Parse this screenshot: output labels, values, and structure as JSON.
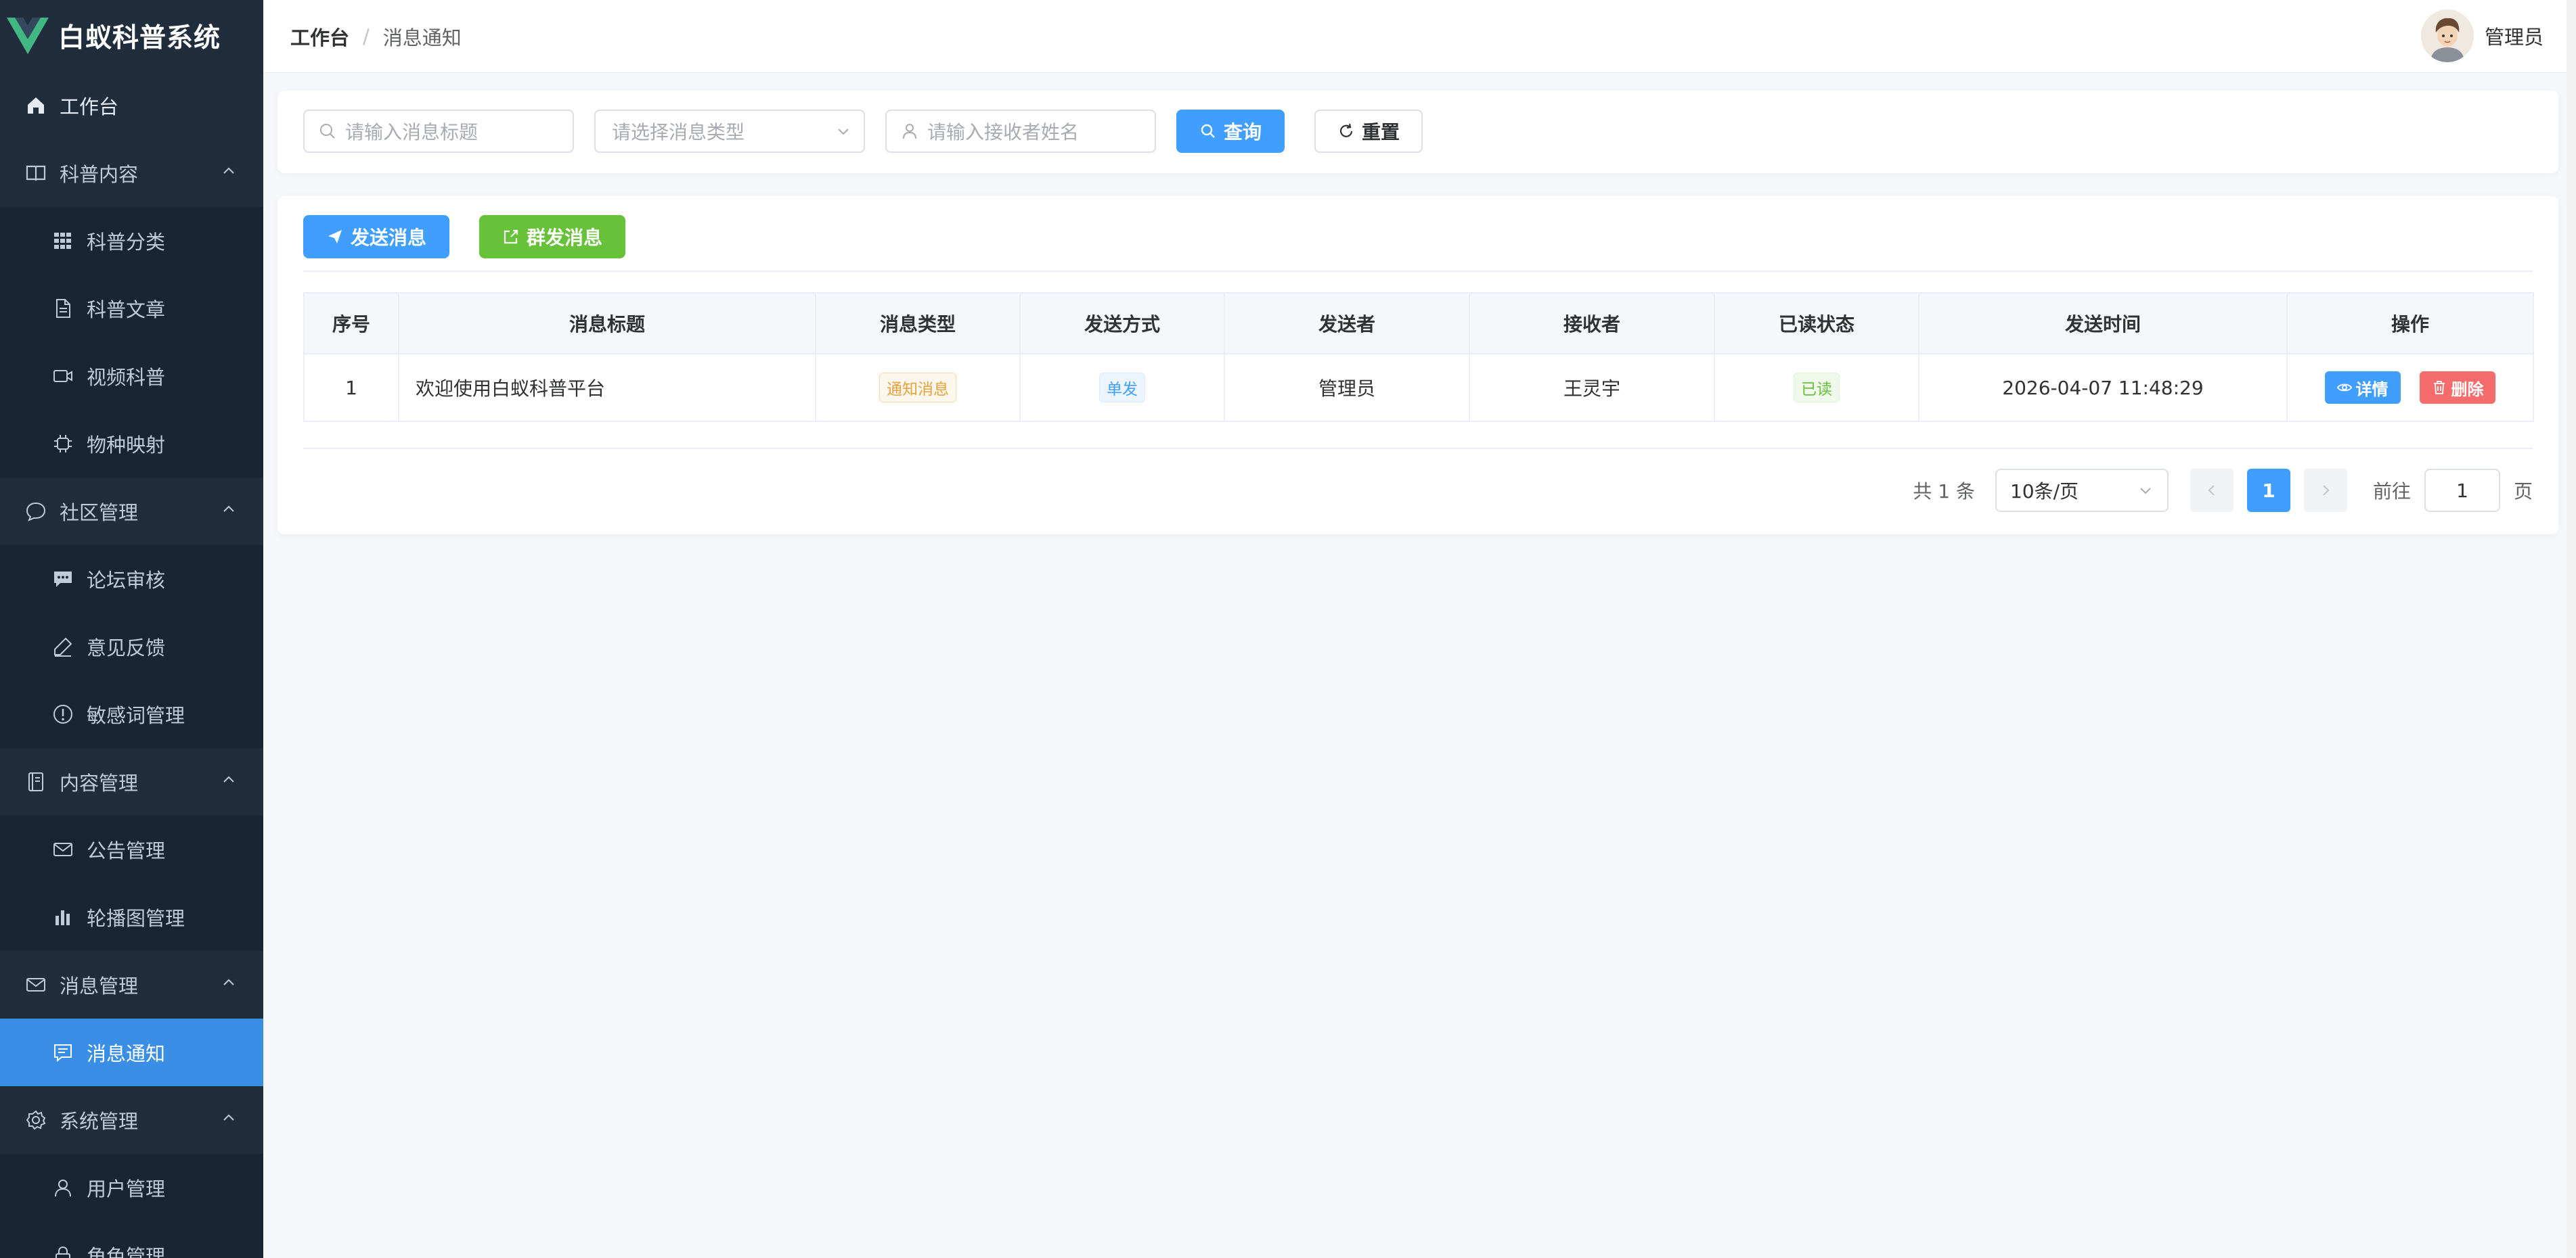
{
  "app": {
    "title": "白蚁科普系统"
  },
  "sidebar": {
    "home": "工作台",
    "groups": [
      {
        "label": "科普内容",
        "icon": "book-icon",
        "items": [
          {
            "label": "科普分类",
            "icon": "grid-icon"
          },
          {
            "label": "科普文章",
            "icon": "document-icon"
          },
          {
            "label": "视频科普",
            "icon": "video-camera-icon"
          },
          {
            "label": "物种映射",
            "icon": "chip-icon"
          }
        ]
      },
      {
        "label": "社区管理",
        "icon": "chat-bubble-icon",
        "items": [
          {
            "label": "论坛审核",
            "icon": "message-icon"
          },
          {
            "label": "意见反馈",
            "icon": "pen-icon"
          },
          {
            "label": "敏感词管理",
            "icon": "warning-icon"
          }
        ]
      },
      {
        "label": "内容管理",
        "icon": "notebook-icon",
        "items": [
          {
            "label": "公告管理",
            "icon": "envelope-icon"
          },
          {
            "label": "轮播图管理",
            "icon": "bar-chart-icon"
          }
        ]
      },
      {
        "label": "消息管理",
        "icon": "envelope-icon",
        "items": [
          {
            "label": "消息通知",
            "icon": "chat-square-icon",
            "active": true
          }
        ]
      },
      {
        "label": "系统管理",
        "icon": "gear-icon",
        "items": [
          {
            "label": "用户管理",
            "icon": "user-icon"
          },
          {
            "label": "角色管理",
            "icon": "lock-icon"
          }
        ]
      }
    ]
  },
  "header": {
    "breadcrumb": {
      "home": "工作台",
      "sep": "/",
      "current": "消息通知"
    },
    "user": "管理员"
  },
  "search": {
    "title_placeholder": "请输入消息标题",
    "type_placeholder": "请选择消息类型",
    "receiver_placeholder": "请输入接收者姓名",
    "query_label": "查询",
    "reset_label": "重置"
  },
  "toolbar": {
    "send_label": "发送消息",
    "broadcast_label": "群发消息"
  },
  "table": {
    "headers": [
      "序号",
      "消息标题",
      "消息类型",
      "发送方式",
      "发送者",
      "接收者",
      "已读状态",
      "发送时间",
      "操作"
    ],
    "rows": [
      {
        "index": "1",
        "title": "欢迎使用白蚁科普平台",
        "type": "通知消息",
        "method": "单发",
        "sender": "管理员",
        "receiver": "王灵宇",
        "read": "已读",
        "time": "2026-04-07 11:48:29",
        "detail": "详情",
        "delete": "删除"
      }
    ]
  },
  "pagination": {
    "total": "共 1 条",
    "page_size": "10条/页",
    "current_page": "1",
    "goto_prefix": "前往",
    "goto_value": "1",
    "goto_suffix": "页"
  },
  "colors": {
    "primary": "#409eff",
    "success": "#67c23a",
    "danger": "#f56c6c",
    "sidebar": "#1f2d3d"
  }
}
